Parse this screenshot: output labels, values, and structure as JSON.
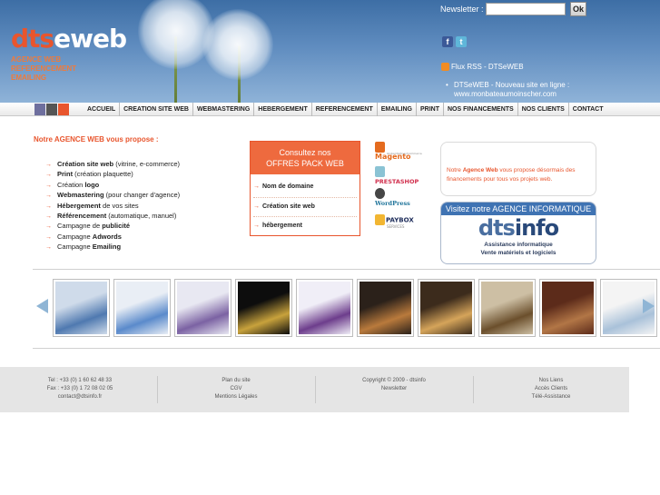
{
  "header": {
    "logo_part1": "dts",
    "logo_part2": "eweb",
    "taglines": [
      "AGENCE WEB",
      "REFERENCEMENT",
      "EMAILING"
    ],
    "newsletter_label": "Newsletter :",
    "newsletter_placeholder": "",
    "newsletter_button": "Ok",
    "rss_label": "Flux RSS - DTSeWEB",
    "rss_item": "DTSeWEB - Nouveau site en ligne : www.monbateaumoinscher.com",
    "brand_color": "#e8552d",
    "social_icons": [
      "facebook-icon",
      "twitter-icon"
    ]
  },
  "nav": {
    "squares": [
      "#6e6f9e",
      "#555555",
      "#e8552d"
    ],
    "items": [
      "ACCUEIL",
      "CREATION SITE WEB",
      "WEBMASTERING",
      "HEBERGEMENT",
      "REFERENCEMENT",
      "EMAILING",
      "PRINT",
      "NOS FINANCEMENTS",
      "NOS CLIENTS",
      "CONTACT"
    ]
  },
  "intro": {
    "title": "Notre AGENCE WEB vous propose :",
    "services": [
      {
        "strong": "Création site web",
        "rest": " (vitrine, e-commerce)",
        "lead": ""
      },
      {
        "strong": "Print",
        "rest": " (création plaquette)",
        "lead": ""
      },
      {
        "strong": "logo",
        "rest": "",
        "lead": "Création "
      },
      {
        "strong": "Webmastering",
        "rest": " (pour changer d'agence)",
        "lead": ""
      },
      {
        "strong": "Hébergement",
        "rest": " de vos sites",
        "lead": ""
      },
      {
        "strong": "Référencement",
        "rest": " (automatique, manuel)",
        "lead": ""
      },
      {
        "strong": "publicité",
        "rest": "",
        "lead": "Campagne de "
      },
      {
        "strong": "Adwords",
        "rest": "",
        "lead": "Campagne "
      },
      {
        "strong": "Emailing",
        "rest": "",
        "lead": "Campagne "
      }
    ]
  },
  "pack": {
    "head_line1": "Consultez nos",
    "head_line2": "OFFRES PACK WEB",
    "items": [
      "Nom de domaine",
      "Création site web",
      "hébergement"
    ]
  },
  "partners": {
    "magento": "Magento",
    "magento_sub": "Global Partner/Commerce",
    "prestashop": "PRESTASHOP",
    "wordpress": "WordPress",
    "paybox": "PAYBOX",
    "paybox_sub": "SERVICES"
  },
  "agence_box": {
    "lead": "Notre ",
    "strong": "Agence Web",
    "rest": " vous propose désormais des financements pour tous vos projets web."
  },
  "dtsinfo": {
    "head": "Visitez notre AGENCE INFORMATIQUE",
    "logo_part1": "dts",
    "logo_part2": "info",
    "line1": "Assistance informatique",
    "line2": "Vente matériels et logiciels"
  },
  "carousel": {
    "thumb_colors": [
      [
        "#cfdbea",
        "#4f79b0"
      ],
      [
        "#e9eef5",
        "#5a8acb"
      ],
      [
        "#e8e8f2",
        "#7b62a3"
      ],
      [
        "#0d0d0d",
        "#c8a23c"
      ],
      [
        "#f0eef7",
        "#6d3d8c"
      ],
      [
        "#2b211a",
        "#b97a3c"
      ],
      [
        "#3c2b1c",
        "#d5a45a"
      ],
      [
        "#cdbfa4",
        "#6b4f2c"
      ],
      [
        "#5c2b1a",
        "#b27646"
      ],
      [
        "#f4f4f4",
        "#a9c1d9"
      ]
    ]
  },
  "footer": {
    "col1": [
      "Tel : +33 (0) 1 60 62 48 33",
      "Fax : +33 (0) 1 72 08 02 05",
      "contact@dtsinfo.fr"
    ],
    "col2": [
      "Plan du site",
      "CGV",
      "Mentions Légales"
    ],
    "col3": [
      "Copyright © 2009 - dtsinfo",
      "Newsletter"
    ],
    "col4": [
      "Nos Liens",
      "Accès Clients",
      "Télé-Assistance"
    ]
  }
}
